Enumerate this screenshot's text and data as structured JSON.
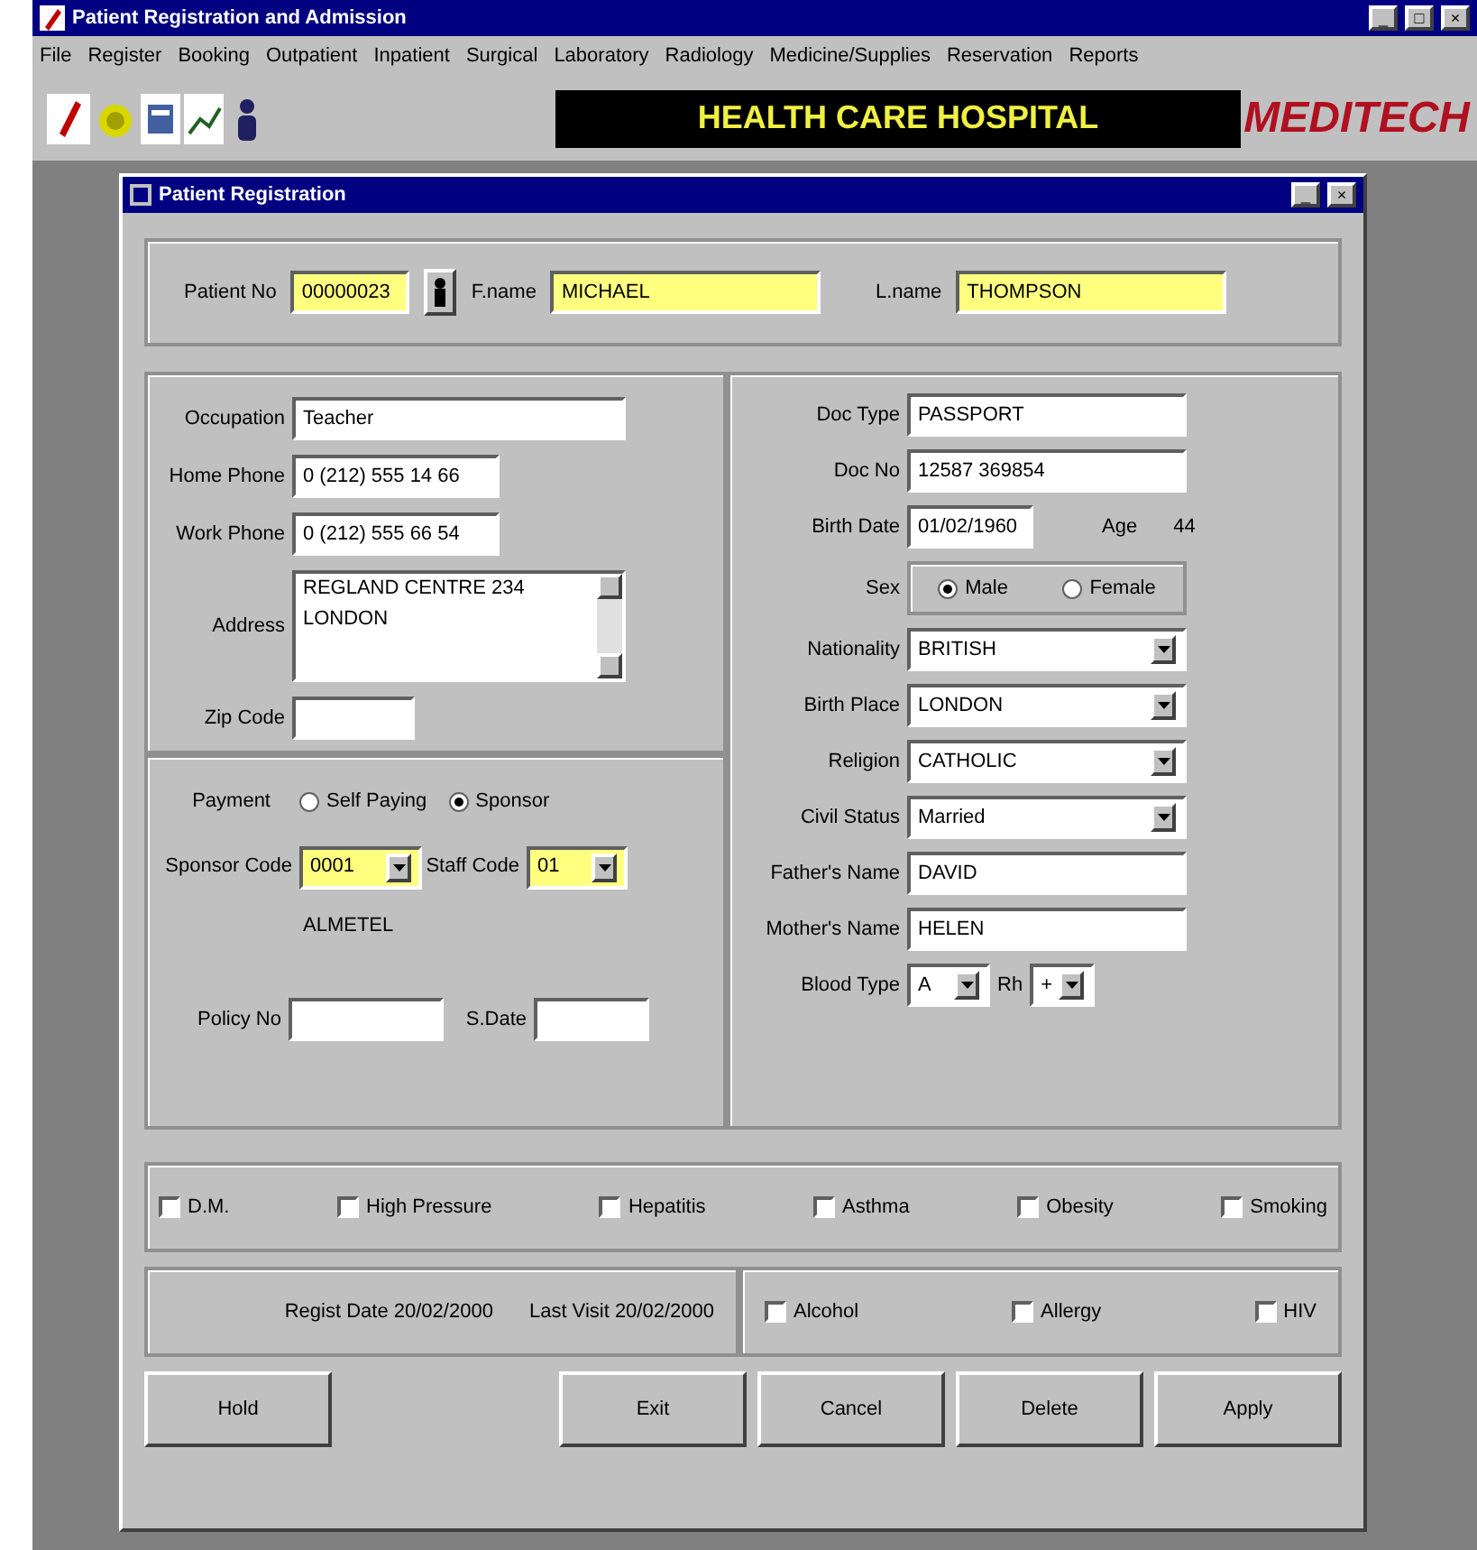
{
  "window": {
    "title": "Patient Registration and Admission",
    "controls": [
      "_",
      "□",
      "×"
    ]
  },
  "menu": [
    "File",
    "Register",
    "Booking",
    "Outpatient",
    "Inpatient",
    "Surgical",
    "Laboratory",
    "Radiology",
    "Medicine/Supplies",
    "Reservation",
    "Reports"
  ],
  "toolbar": {
    "banner": "HEALTH CARE HOSPITAL",
    "logo": "MEDITECH"
  },
  "dialog": {
    "title": "Patient Registration",
    "controls": [
      "_",
      "×"
    ],
    "header_fields": [
      {
        "label": "Patient No",
        "value": "00000023"
      },
      {
        "label": "F.name",
        "value": "MICHAEL"
      },
      {
        "label": "L.name",
        "value": "THOMPSON"
      }
    ],
    "contact_fields": [
      {
        "kind": "text",
        "label": "Occupation",
        "value": "Teacher"
      },
      {
        "kind": "short",
        "label": "Home Phone",
        "value": "0 (212) 555 14 66"
      },
      {
        "kind": "short",
        "label": "Work Phone",
        "value": "0 (212) 555 66 54"
      },
      {
        "kind": "memo",
        "label": "Address",
        "lines": [
          "REGLAND CENTRE 234",
          "LONDON"
        ]
      },
      {
        "kind": "zip",
        "label": "Zip Code"
      }
    ],
    "payment": {
      "label": "Payment",
      "options": [
        {
          "label": "Self Paying",
          "selected": false
        },
        {
          "label": "Sponsor",
          "selected": true
        }
      ],
      "sponsor_code": {
        "label": "Sponsor Code",
        "value": "0001"
      },
      "staff_code": {
        "label": "Staff Code",
        "value": "01"
      },
      "sponsor_name": "ALMETEL",
      "policy_no": {
        "label": "Policy No"
      },
      "s_date": {
        "label": "S.Date"
      }
    },
    "personal_fields": [
      {
        "kind": "text",
        "label": "Doc Type",
        "value": "PASSPORT"
      },
      {
        "kind": "text",
        "label": "Doc No",
        "value": "12587 369854"
      },
      {
        "kind": "birth",
        "label": "Birth Date",
        "value": "01/02/1960",
        "age_label": "Age",
        "age": "44"
      },
      {
        "kind": "sex",
        "label": "Sex",
        "options": [
          {
            "label": "Male",
            "selected": true
          },
          {
            "label": "Female",
            "selected": false
          }
        ]
      },
      {
        "kind": "dropdown",
        "label": "Nationality",
        "value": "BRITISH"
      },
      {
        "kind": "dropdown",
        "label": "Birth Place",
        "value": "LONDON"
      },
      {
        "kind": "dropdown",
        "label": "Religion",
        "value": "CATHOLIC"
      },
      {
        "kind": "dropdown",
        "label": "Civil Status",
        "value": "Married"
      },
      {
        "kind": "text",
        "label": "Father's Name",
        "value": "DAVID"
      },
      {
        "kind": "text",
        "label": "Mother's Name",
        "value": "HELEN"
      },
      {
        "kind": "blood",
        "label": "Blood Type",
        "value": "A",
        "rh_label": "Rh",
        "rh": "+"
      }
    ],
    "conditions": [
      {
        "label": "D.M.",
        "checked": false
      },
      {
        "label": "High Pressure",
        "checked": false
      },
      {
        "label": "Hepatitis",
        "checked": false
      },
      {
        "label": "Asthma",
        "checked": false
      },
      {
        "label": "Obesity",
        "checked": false
      },
      {
        "label": "Smoking",
        "checked": false
      }
    ],
    "dates": [
      "Regist Date 20/02/2000",
      "Last Visit 20/02/2000"
    ],
    "habits": [
      {
        "label": "Alcohol",
        "checked": false
      },
      {
        "label": "Allergy",
        "checked": false
      },
      {
        "label": "HIV",
        "checked": false
      }
    ],
    "buttons": [
      "Hold",
      "Exit",
      "Cancel",
      "Delete",
      "Apply"
    ]
  }
}
